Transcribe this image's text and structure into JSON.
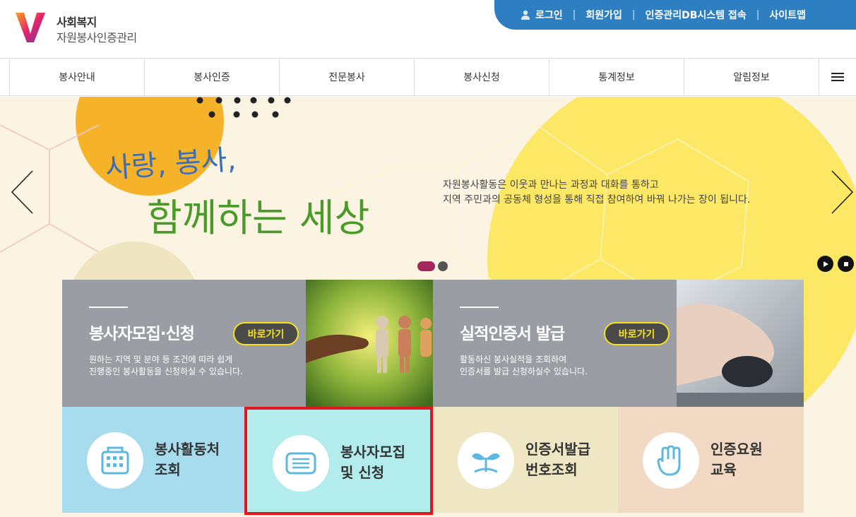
{
  "logo": {
    "line1": "사회복지",
    "line2": "자원봉사인증관리"
  },
  "top_links": [
    {
      "label": "로그인",
      "icon": "person-icon"
    },
    {
      "label": "회원가입"
    },
    {
      "label": "인증관리DB시스템 접속"
    },
    {
      "label": "사이트맵"
    }
  ],
  "nav": {
    "items": [
      "봉사안내",
      "봉사인증",
      "전문봉사",
      "봉사신청",
      "통계정보",
      "알림정보"
    ],
    "menu_icon": "hamburger-icon"
  },
  "hero": {
    "headline_line1": "사랑, 봉사,",
    "headline_line2": "함께하는 세상",
    "text_line1": "자원봉사활동은 이웃과 만나는 과정과 대화를 통하고",
    "text_line2": "지역 주민과의 공동체 형성을 통해 직접 참여하여 바꿔 나가는 장이 됩니다.",
    "slide_count": 2,
    "active_slide": 1
  },
  "cards": [
    {
      "title": "봉사자모집·신청",
      "button": "바로가기",
      "desc_line1": "원하는 지역 및 분야 등 조건에 따라 쉽게",
      "desc_line2": "진행중인 봉사활동을 신청하실 수 있습니다."
    },
    {
      "title": "실적인증서 발급",
      "button": "바로가기",
      "desc_line1": "활동하신 봉사실적을 조회하여",
      "desc_line2": "인증서를 발급 신청하실수 있습니다."
    }
  ],
  "tiles": [
    {
      "label": "봉사활동처\n조회",
      "icon": "building-icon",
      "bg": "#a7dcee"
    },
    {
      "label": "봉사자모집\n및 신청",
      "icon": "book-icon",
      "bg": "#b2ecec"
    },
    {
      "label": "인증서발급\n번호조회",
      "icon": "sprout-icon",
      "bg": "#efe6c3"
    },
    {
      "label": "인증요원\n교육",
      "icon": "hand-icon",
      "bg": "#f2d9c4"
    }
  ],
  "colors": {
    "topbar": "#2e7fc1",
    "highlight": "#e3161f",
    "button_border": "#f7e21b"
  }
}
